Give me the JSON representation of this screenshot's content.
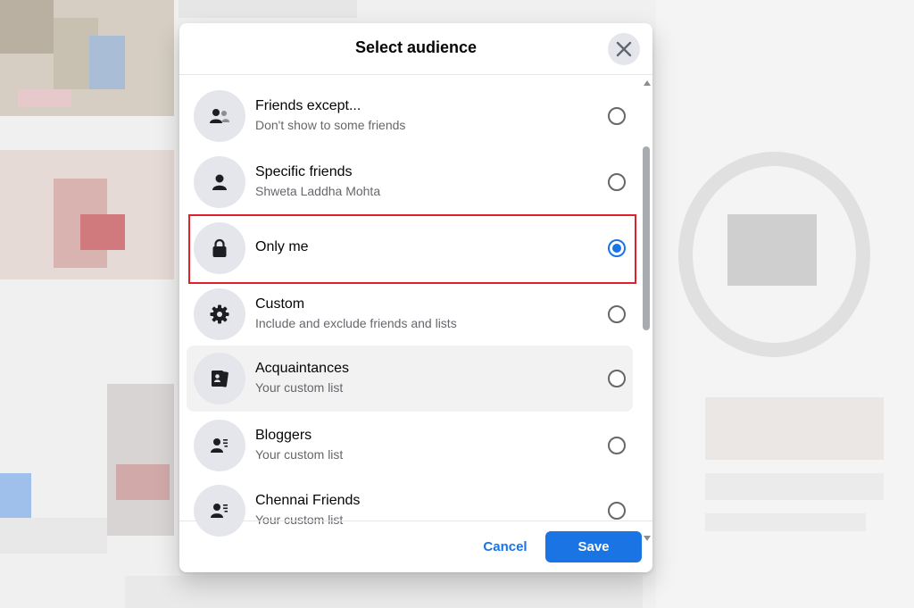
{
  "dialog": {
    "title": "Select audience",
    "close_icon": "close-icon",
    "cancel_label": "Cancel",
    "save_label": "Save"
  },
  "audience_options": [
    {
      "label": "Friends except...",
      "sublabel": "Don't show to some friends",
      "icon": "friends-except-icon",
      "selected": false
    },
    {
      "label": "Specific friends",
      "sublabel": "Shweta Laddha Mohta",
      "icon": "person-icon",
      "selected": false
    },
    {
      "label": "Only me",
      "sublabel": "",
      "icon": "lock-icon",
      "selected": true
    },
    {
      "label": "Custom",
      "sublabel": "Include and exclude friends and lists",
      "icon": "gear-icon",
      "selected": false
    },
    {
      "label": "Acquaintances",
      "sublabel": "Your custom list",
      "icon": "acquaintances-icon",
      "selected": false
    },
    {
      "label": "Bloggers",
      "sublabel": "Your custom list",
      "icon": "person-list-icon",
      "selected": false
    },
    {
      "label": "Chennai Friends",
      "sublabel": "Your custom list",
      "icon": "person-list-icon",
      "selected": false
    }
  ],
  "colors": {
    "accent": "#1b74e4",
    "highlight_box": "#e0202d",
    "icon_bg": "#e4e6eb",
    "secondary_text": "#65676b"
  }
}
